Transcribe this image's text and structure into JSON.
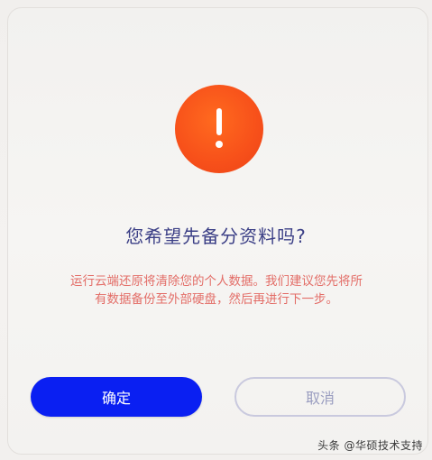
{
  "dialog": {
    "icon": "exclamation-warning-icon",
    "accent_color": "#f7501a",
    "title": "您希望先备分资料吗?",
    "message_line1": "运行云端还原将清除您的个人数据。我们建议您先将所",
    "message_line2": "有数据备份至外部硬盘，然后再进行下一步。",
    "confirm_label": "确定",
    "confirm_color": "#0a1ff2",
    "cancel_label": "取消"
  },
  "watermark": {
    "text": "头条 @华硕技术支持"
  }
}
